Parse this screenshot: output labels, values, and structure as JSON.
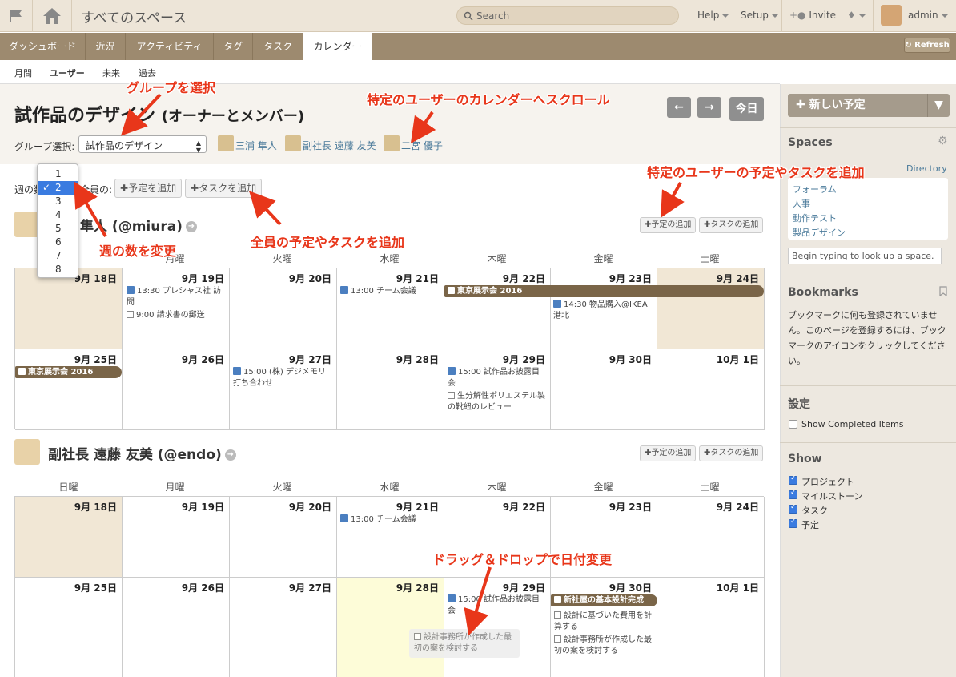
{
  "topbar": {
    "space_title": "すべてのスペース",
    "search_placeholder": "Search",
    "help": "Help",
    "setup": "Setup",
    "invite": "Invite",
    "user": "admin"
  },
  "tabs": [
    "ダッシュボード",
    "近況",
    "アクティビティ",
    "タグ",
    "タスク",
    "カレンダー"
  ],
  "active_tab": "カレンダー",
  "refresh": "Refresh",
  "subnav": [
    "月間",
    "ユーザー",
    "未来",
    "過去"
  ],
  "header": {
    "title": "試作品のデザイン",
    "title_sub": "(オーナーとメンバー)",
    "today": "今日",
    "group_label": "グループ選択:",
    "group_value": "試作品のデザイン",
    "members": [
      "三浦 隼人",
      "副社長 遠藤 友美",
      "二宮 優子"
    ]
  },
  "controls": {
    "weeks_label": "週の数",
    "all_label": "全員の:",
    "add_event": "予定を追加",
    "add_task": "タスクを追加",
    "week_options": [
      "1",
      "2",
      "3",
      "4",
      "5",
      "6",
      "7",
      "8"
    ],
    "week_selected": "2"
  },
  "user_buttons": {
    "add_event": "予定の追加",
    "add_task": "タスクの追加"
  },
  "weekdays": [
    "日曜",
    "月曜",
    "火曜",
    "水曜",
    "木曜",
    "金曜",
    "土曜"
  ],
  "users": [
    {
      "name": "隼人 (@miura)",
      "dates": [
        [
          "9月 18日",
          "9月 19日",
          "9月 20日",
          "9月 21日",
          "9月 22日",
          "9月 23日",
          "9月 24日"
        ],
        [
          "9月 25日",
          "9月 26日",
          "9月 27日",
          "9月 28日",
          "9月 29日",
          "9月 30日",
          "10月 1日"
        ]
      ],
      "events": {
        "w1_mon_1": "13:30 プレシャス社 訪問",
        "w1_mon_2": "9:00 請求書の郵送",
        "w1_wed_1": "13:00 チーム会議",
        "w1_bar": "東京展示会 2016",
        "w1_fri_1": "14:30 物品購入@IKEA港北",
        "w2_bar": "東京展示会 2016",
        "w2_tue_1": "15:00 (株) デジメモリ 打ち合わせ",
        "w2_thu_1": "15:00 試作品お披露目会",
        "w2_thu_2": "生分解性ポリエステル製の靴紐のレビュー"
      }
    },
    {
      "name": "副社長 遠藤 友美 (@endo)",
      "dates": [
        [
          "9月 18日",
          "9月 19日",
          "9月 20日",
          "9月 21日",
          "9月 22日",
          "9月 23日",
          "9月 24日"
        ],
        [
          "9月 25日",
          "9月 26日",
          "9月 27日",
          "9月 28日",
          "9月 29日",
          "9月 30日",
          "10月 1日"
        ]
      ],
      "events": {
        "w1_wed_1": "13:00 チーム会議",
        "w2_thu_1": "15:00 試作品お披露目会",
        "w2_bar": "新社屋の基本設計完成",
        "w2_fri_1": "設計に基づいた費用を計算する",
        "w2_fri_2": "設計事務所が作成した最初の案を検討する",
        "drag_item": "設計事務所が作成した最初の案を検討する"
      }
    }
  ],
  "sidebar": {
    "new_event": "新しい予定",
    "spaces_title": "Spaces",
    "directory": "Directory",
    "spaces": [
      "フォーラム",
      "人事",
      "動作テスト",
      "製品デザイン"
    ],
    "space_lookup_placeholder": "Begin typing to look up a space.",
    "bookmarks_title": "Bookmarks",
    "bookmarks_text": "ブックマークに何も登録されていません。このページを登録するには、ブックマークのアイコンをクリックしてください。",
    "settings_title": "設定",
    "show_completed": "Show Completed Items",
    "show_title": "Show",
    "show_items": [
      "プロジェクト",
      "マイルストーン",
      "タスク",
      "予定"
    ]
  },
  "annotations": {
    "select_group": "グループを選択",
    "scroll_user": "特定のユーザーのカレンダーへスクロール",
    "add_user_item": "特定のユーザーの予定やタスクを追加",
    "change_weeks": "週の数を変更",
    "add_all_item": "全員の予定やタスクを追加",
    "drag_drop": "ドラッグ＆ドロップで日付変更"
  },
  "colors": {
    "tab_bar": "#9d8a6f",
    "bar_event": "#7a6548",
    "sunday": "#f1e7d5",
    "highlight": "#fdfcd8",
    "annotation": "#e8361a",
    "checked": "#3a7be0"
  }
}
